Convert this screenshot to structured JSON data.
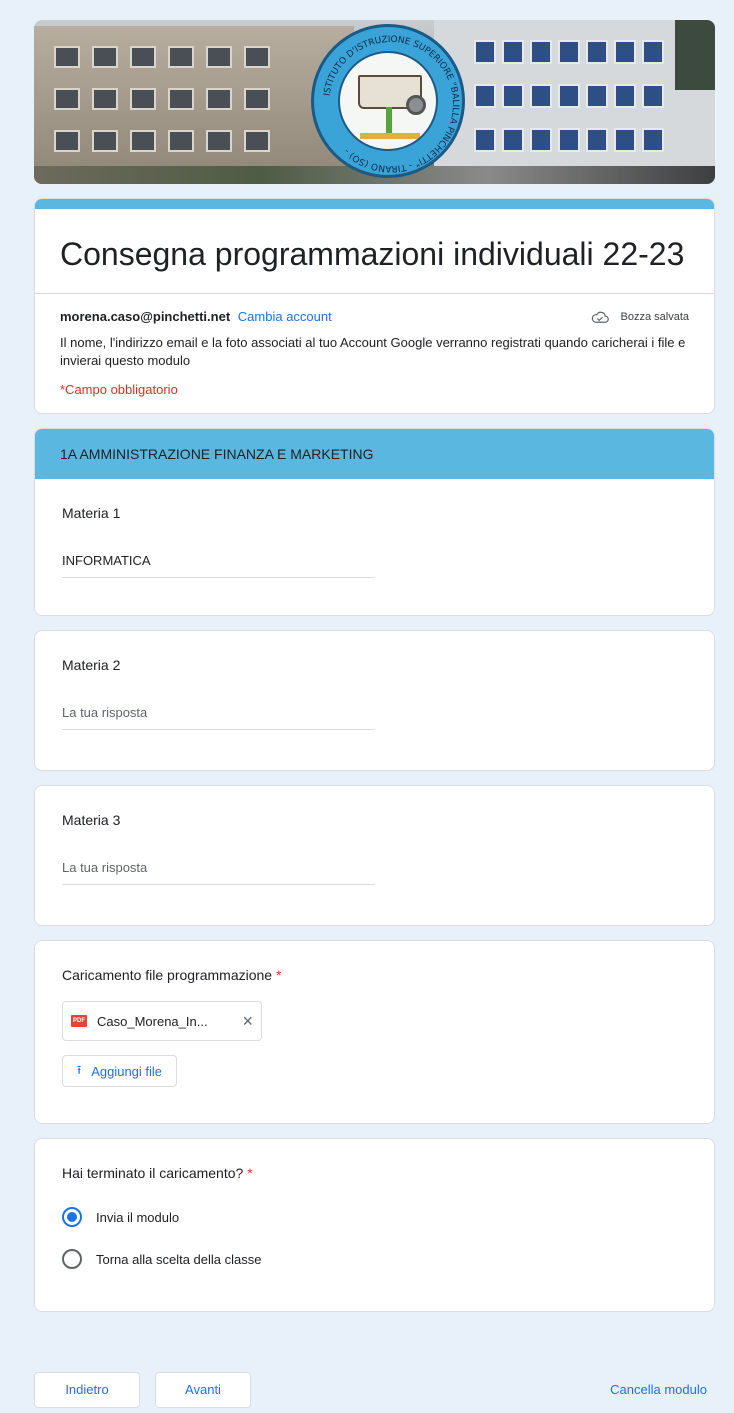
{
  "header": {
    "banner_logo_text": "ISTITUTO D'ISTRUZIONE SUPERIORE \"BALILLA PINCHETTI\" - TIRANO (SO) -",
    "form_title": "Consegna programmazioni individuali 22-23"
  },
  "account": {
    "email": "morena.caso@pinchetti.net",
    "change_label": "Cambia account",
    "draft_status": "Bozza salvata",
    "notice": "Il nome, l'indirizzo email e la foto associati al tuo Account Google verranno registrati quando caricherai i file e invierai questo modulo",
    "required_note": "*Campo obbligatorio"
  },
  "section": {
    "title": "1A AMMINISTRAZIONE FINANZA E MARKETING"
  },
  "questions": {
    "materia1": {
      "label": "Materia 1",
      "value": "INFORMATICA"
    },
    "materia2": {
      "label": "Materia 2",
      "placeholder": "La tua risposta"
    },
    "materia3": {
      "label": "Materia 3",
      "placeholder": "La tua risposta"
    },
    "upload": {
      "label": "Caricamento file programmazione",
      "required_mark": "*",
      "file_name": "Caso_Morena_In...",
      "file_type": "PDF",
      "add_label": "Aggiungi file"
    },
    "done": {
      "label": "Hai terminato il caricamento?",
      "required_mark": "*",
      "options": [
        {
          "label": "Invia il modulo",
          "selected": true
        },
        {
          "label": "Torna alla scelta della classe",
          "selected": false
        }
      ]
    }
  },
  "footer": {
    "back_label": "Indietro",
    "next_label": "Avanti",
    "clear_label": "Cancella modulo"
  },
  "colors": {
    "accent": "#5ab8e0",
    "link": "#1a73e8",
    "required": "#d93025",
    "background": "#e8f1f9"
  }
}
